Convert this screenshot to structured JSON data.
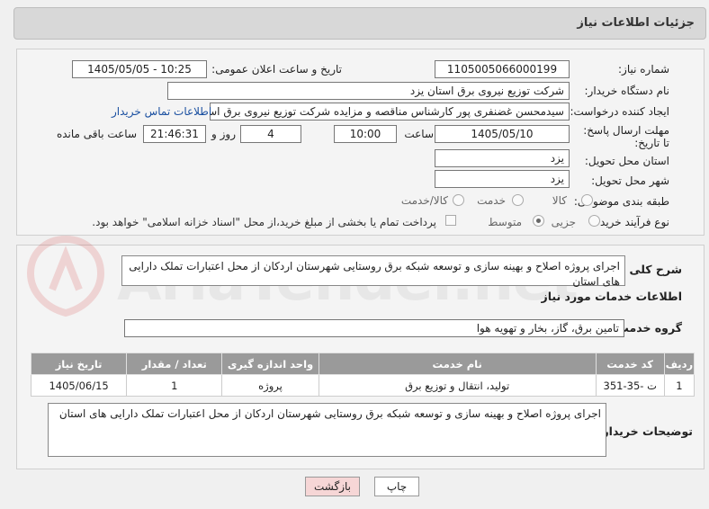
{
  "header": {
    "title": "جزئیات اطلاعات نیاز"
  },
  "form": {
    "need_number": {
      "label": "شماره نیاز:",
      "value": "1105005066000199"
    },
    "announce_datetime": {
      "label": "تاریخ و ساعت اعلان عمومی:",
      "value": "1405/05/05 - 10:25"
    },
    "buyer_org": {
      "label": "نام دستگاه خریدار:",
      "value": "شرکت توزیع نیروی برق استان یزد"
    },
    "requester": {
      "label": "ایجاد کننده درخواست:",
      "value": "سیدمحسن غضنفری پور کارشناس مناقصه و مزایده شرکت توزیع نیروی برق است",
      "contact_link": "اطلاعات تماس خریدار"
    },
    "deadline": {
      "label": "مهلت ارسال پاسخ: تا تاریخ:",
      "date": "1405/05/10",
      "time_label": "ساعت",
      "time": "10:00",
      "days": "4",
      "days_label": "روز و",
      "remaining": "21:46:31",
      "remaining_label": "ساعت باقی مانده"
    },
    "province": {
      "label": "استان محل تحویل:",
      "value": "یزد"
    },
    "city": {
      "label": "شهر محل تحویل:",
      "value": "یزد"
    },
    "category": {
      "label": "طبقه بندی موضوعی:",
      "options": [
        "کالا",
        "خدمت",
        "کالا/خدمت"
      ]
    },
    "process": {
      "label": "نوع فرآیند خرید :",
      "options": [
        "جزیی",
        "متوسط"
      ],
      "payment_note": "پرداخت تمام یا بخشی از مبلغ خرید،از محل \"اسناد خزانه اسلامی\" خواهد بود."
    }
  },
  "details": {
    "summary_label": "شرح کلی نیاز:",
    "summary": "اجرای پروژه اصلاح و بهینه سازی و توسعه شبکه برق روستایی شهرستان اردکان از محل اعتبارات تملک دارایی های استان",
    "services_title": "اطلاعات خدمات مورد نیاز",
    "service_group_label": "گروه خدمت:",
    "service_group": "تامین برق، گاز، بخار و تهویه هوا",
    "table": {
      "headers": [
        "ردیف",
        "کد خدمت",
        "نام خدمت",
        "واحد اندازه گیری",
        "تعداد / مقدار",
        "تاریخ نیاز"
      ],
      "rows": [
        [
          "1",
          "ت -35-351",
          "تولید، انتقال و توزیع برق",
          "پروژه",
          "1",
          "1405/06/15"
        ]
      ]
    },
    "buyer_notes_label": "توضیحات خریدار:",
    "buyer_notes": "اجرای پروژه اصلاح و بهینه سازی و توسعه شبکه برق روستایی شهرستان اردکان از محل اعتبارات تملک دارایی های استان"
  },
  "buttons": {
    "print": "چاپ",
    "back": "بازگشت"
  },
  "watermark": "AriaTender.net",
  "colors": {
    "link": "#1a4fa0",
    "header_bg": "#d8d8d8",
    "table_header": "#9a9a9a",
    "back_btn": "#f6d6d6"
  }
}
